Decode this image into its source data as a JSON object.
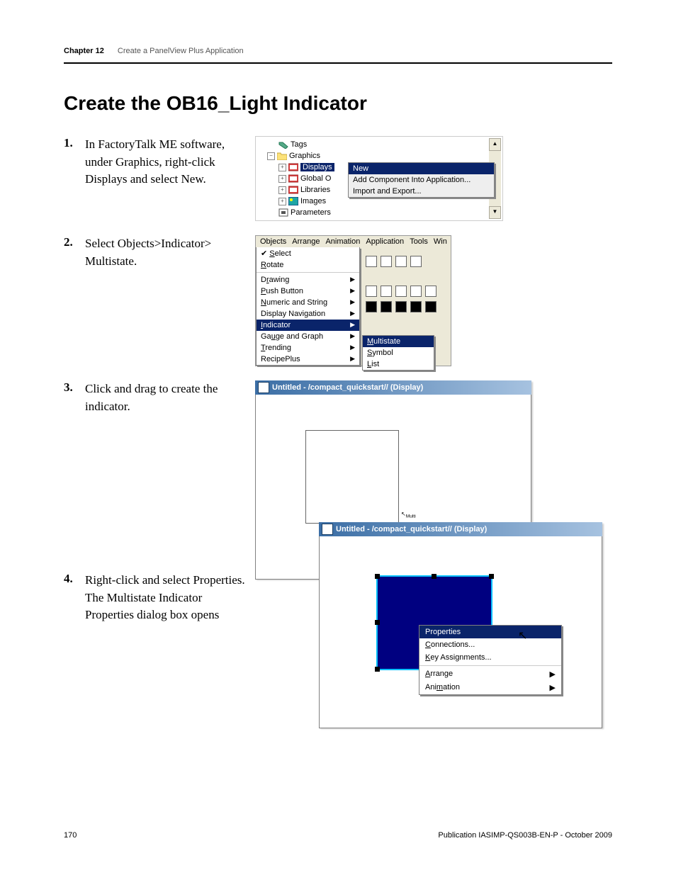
{
  "header": {
    "chapter": "Chapter  12",
    "chapter_title": "Create a PanelView Plus Application"
  },
  "section_title": "Create the OB16_Light Indicator",
  "steps": {
    "s1": {
      "num": "1.",
      "text": "In FactoryTalk ME software, under Graphics, right-click Displays and select New."
    },
    "s2": {
      "num": "2.",
      "text": "Select Objects>Indicator> Multistate."
    },
    "s3": {
      "num": "3.",
      "text": "Click and drag to create the indicator."
    },
    "s4": {
      "num": "4.",
      "text": "Right-click and select Properties."
    },
    "s4b": "The Multistate Indicator Properties dialog box opens"
  },
  "fig1": {
    "tree": {
      "tags": "Tags",
      "graphics": "Graphics",
      "displays": "Displays",
      "global": "Global O",
      "libraries": "Libraries",
      "images": "Images",
      "parameters": "Parameters"
    },
    "menu": {
      "new": "New",
      "add": "Add Component Into Application...",
      "import": "Import and Export..."
    }
  },
  "fig2": {
    "menubar": {
      "objects": "Objects",
      "arrange": "Arrange",
      "animation": "Animation",
      "application": "Application",
      "tools": "Tools",
      "win": "Win"
    },
    "menu": {
      "select": "Select",
      "rotate": "Rotate",
      "drawing": "Drawing",
      "push": "Push Button",
      "numeric": "Numeric and  String",
      "dispnav": "Display Navigation",
      "indicator": "Indicator",
      "gauge": "Gauge and Graph",
      "trending": "Trending",
      "recipe": "RecipePlus"
    },
    "sub": {
      "multistate": "Multistate",
      "symbol": "Symbol",
      "list": "List"
    }
  },
  "fig3": {
    "title1": "Untitled - /compact_quickstart// (Display)",
    "title2": "Untitled - /compact_quickstart// (Display)",
    "cursor_label": "Multi\nInd",
    "ctx": {
      "properties": "Properties",
      "connections": "Connections...",
      "key": "Key Assignments...",
      "arrange": "Arrange",
      "animation": "Animation"
    }
  },
  "footer": {
    "page": "170",
    "pub": "Publication IASIMP-QS003B-EN-P - October 2009"
  }
}
